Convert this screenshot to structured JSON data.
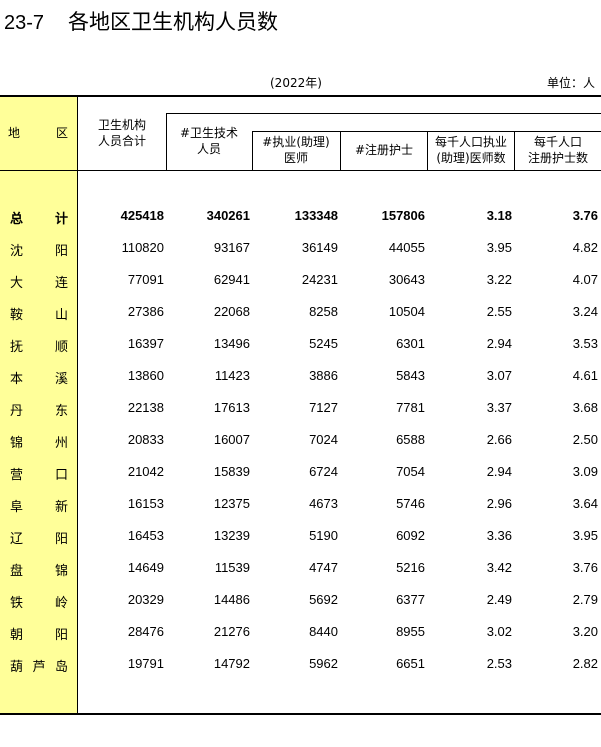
{
  "title": {
    "number": "23-7",
    "text": "各地区卫生机构人员数"
  },
  "year_note": "(2022年)",
  "unit_note": "单位：人",
  "headers": {
    "region": [
      "地",
      "区"
    ],
    "total": [
      "卫生机构",
      "人员合计"
    ],
    "tech": [
      "#卫生技术",
      "人员"
    ],
    "doctors": [
      "#执业(助理)",
      "医师"
    ],
    "nurses": "#注册护士",
    "doctors_per_k": [
      "每千人口执业",
      "(助理)医师数"
    ],
    "nurses_per_k": [
      "每千人口",
      "注册护士数"
    ]
  },
  "rows": [
    {
      "region": [
        "总",
        "计"
      ],
      "total": "425418",
      "tech": "340261",
      "doctors": "133348",
      "nurses": "157806",
      "doctors_per_k": "3.18",
      "nurses_per_k": "3.76"
    },
    {
      "region": [
        "沈",
        "阳"
      ],
      "total": "110820",
      "tech": "93167",
      "doctors": "36149",
      "nurses": "44055",
      "doctors_per_k": "3.95",
      "nurses_per_k": "4.82"
    },
    {
      "region": [
        "大",
        "连"
      ],
      "total": "77091",
      "tech": "62941",
      "doctors": "24231",
      "nurses": "30643",
      "doctors_per_k": "3.22",
      "nurses_per_k": "4.07"
    },
    {
      "region": [
        "鞍",
        "山"
      ],
      "total": "27386",
      "tech": "22068",
      "doctors": "8258",
      "nurses": "10504",
      "doctors_per_k": "2.55",
      "nurses_per_k": "3.24"
    },
    {
      "region": [
        "抚",
        "顺"
      ],
      "total": "16397",
      "tech": "13496",
      "doctors": "5245",
      "nurses": "6301",
      "doctors_per_k": "2.94",
      "nurses_per_k": "3.53"
    },
    {
      "region": [
        "本",
        "溪"
      ],
      "total": "13860",
      "tech": "11423",
      "doctors": "3886",
      "nurses": "5843",
      "doctors_per_k": "3.07",
      "nurses_per_k": "4.61"
    },
    {
      "region": [
        "丹",
        "东"
      ],
      "total": "22138",
      "tech": "17613",
      "doctors": "7127",
      "nurses": "7781",
      "doctors_per_k": "3.37",
      "nurses_per_k": "3.68"
    },
    {
      "region": [
        "锦",
        "州"
      ],
      "total": "20833",
      "tech": "16007",
      "doctors": "7024",
      "nurses": "6588",
      "doctors_per_k": "2.66",
      "nurses_per_k": "2.50"
    },
    {
      "region": [
        "营",
        "口"
      ],
      "total": "21042",
      "tech": "15839",
      "doctors": "6724",
      "nurses": "7054",
      "doctors_per_k": "2.94",
      "nurses_per_k": "3.09"
    },
    {
      "region": [
        "阜",
        "新"
      ],
      "total": "16153",
      "tech": "12375",
      "doctors": "4673",
      "nurses": "5746",
      "doctors_per_k": "2.96",
      "nurses_per_k": "3.64"
    },
    {
      "region": [
        "辽",
        "阳"
      ],
      "total": "16453",
      "tech": "13239",
      "doctors": "5190",
      "nurses": "6092",
      "doctors_per_k": "3.36",
      "nurses_per_k": "3.95"
    },
    {
      "region": [
        "盘",
        "锦"
      ],
      "total": "14649",
      "tech": "11539",
      "doctors": "4747",
      "nurses": "5216",
      "doctors_per_k": "3.42",
      "nurses_per_k": "3.76"
    },
    {
      "region": [
        "铁",
        "岭"
      ],
      "total": "20329",
      "tech": "14486",
      "doctors": "5692",
      "nurses": "6377",
      "doctors_per_k": "2.49",
      "nurses_per_k": "2.79"
    },
    {
      "region": [
        "朝",
        "阳"
      ],
      "total": "28476",
      "tech": "21276",
      "doctors": "8440",
      "nurses": "8955",
      "doctors_per_k": "3.02",
      "nurses_per_k": "3.20"
    },
    {
      "region": [
        "葫",
        "芦",
        "岛"
      ],
      "total": "19791",
      "tech": "14792",
      "doctors": "5962",
      "nurses": "6651",
      "doctors_per_k": "2.53",
      "nurses_per_k": "2.82"
    }
  ]
}
